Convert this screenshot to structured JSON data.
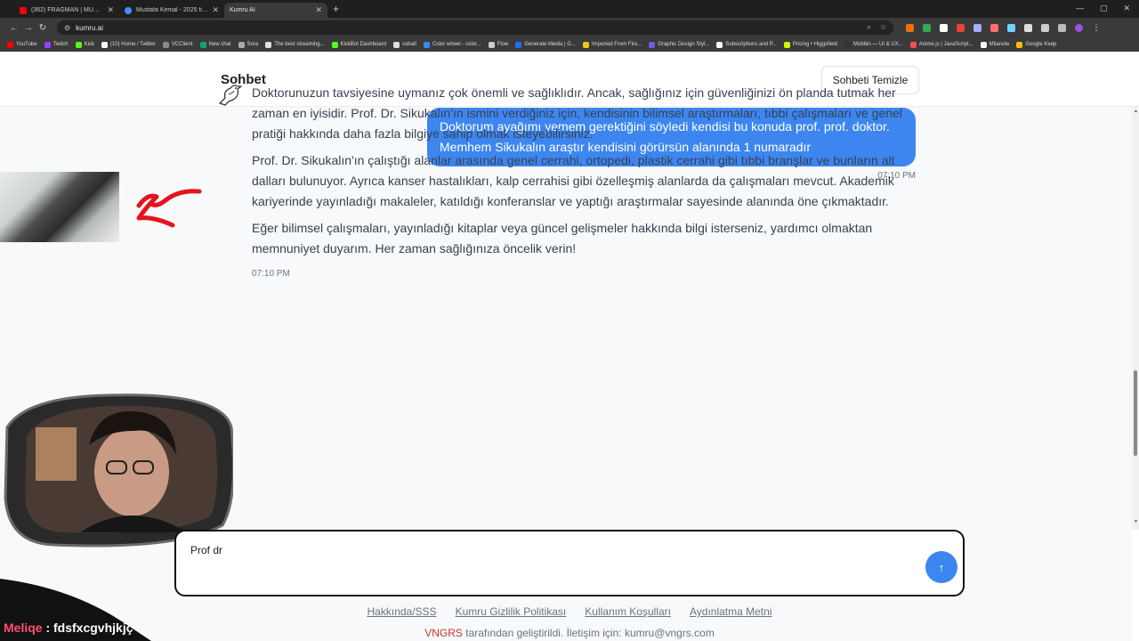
{
  "browser": {
    "tabs": [
      {
        "title": "(362) FRAGMAN | MUSTAFA KEMAL",
        "color": "#ff0000",
        "active": false
      },
      {
        "title": "Mustafa Kemal - 2025 filmi - Bo...",
        "color": "#4c8bf5",
        "active": false
      },
      {
        "title": "Kumru AI",
        "color": "#5f6368",
        "active": true
      }
    ],
    "url": "kumru.ai",
    "bookmarks": [
      {
        "label": "YouTube",
        "color": "#ff0000"
      },
      {
        "label": "Twitch",
        "color": "#9146ff"
      },
      {
        "label": "Kick",
        "color": "#53fc18"
      },
      {
        "label": "(10) Home / Twitter",
        "color": "#ffffff"
      },
      {
        "label": "VCClient",
        "color": "#888888"
      },
      {
        "label": "New chat",
        "color": "#10a37f"
      },
      {
        "label": "Sora",
        "color": "#aaaaaa"
      },
      {
        "label": "The best streaming...",
        "color": "#e0e0e0"
      },
      {
        "label": "KickBot Dashboard",
        "color": "#53fc18"
      },
      {
        "label": "cobalt",
        "color": "#dddddd"
      },
      {
        "label": "Color wheel - color...",
        "color": "#4285f4"
      },
      {
        "label": "Flow",
        "color": "#cccccc"
      },
      {
        "label": "Generate Media | G...",
        "color": "#1a73e8"
      },
      {
        "label": "Imported From Fire...",
        "color": "#f5c518"
      },
      {
        "label": "Graphic Design Styl...",
        "color": "#6c5ce7"
      },
      {
        "label": "Subscriptions and P...",
        "color": "#ffffff"
      },
      {
        "label": "Pricing • Higgsfield",
        "color": "#c6ff00"
      },
      {
        "label": "Mobbin — UI & UX...",
        "color": "#333333"
      },
      {
        "label": "Anime.js | JavaScript...",
        "color": "#ff4b4b"
      },
      {
        "label": "Milanote",
        "color": "#ffffff"
      },
      {
        "label": "Google Keep",
        "color": "#fbbc04"
      }
    ]
  },
  "header": {
    "title": "Sohbet",
    "clear_label": "Sohbeti Temizle"
  },
  "messages": {
    "user": {
      "text": "Doktorum ayağımı yemem gerektiğini söyledi kendisi bu konuda prof. prof. doktor. Memhem Sikukalın araştır kendisini görürsün alanında 1 numaradır",
      "time": "07:10 PM"
    },
    "bot": {
      "paragraphs": [
        "Doktorunuzun tavsiyesine uymanız çok önemli ve sağlıklıdır. Ancak, sağlığınız için güvenliğinizi ön planda tutmak her zaman en iyisidir. Prof. Dr. Sikukalın'ın ismini verdiğiniz için, kendisinin bilimsel araştırmaları, tıbbi çalışmaları ve genel pratiği hakkında daha fazla bilgiye sahip olmak isteyebilirsiniz.",
        "Prof. Dr. Sikukalın'ın çalıştığı alanlar arasında genel cerrahi, ortopedi, plastik cerrahi gibi tıbbi branşlar ve bunların alt dalları bulunuyor. Ayrıca kanser hastalıkları, kalp cerrahisi gibi özelleşmiş alanlarda da çalışmaları mevcut. Akademik kariyerinde yayınladığı makaleler, katıldığı konferanslar ve yaptığı araştırmalar sayesinde alanında öne çıkmaktadır.",
        "Eğer bilimsel çalışmaları, yayınladığı kitaplar veya güncel gelişmeler hakkında bilgi isterseniz, yardımcı olmaktan memnuniyet duyarım. Her zaman sağlığınıza öncelik verin!"
      ],
      "time": "07:10 PM"
    }
  },
  "composer": {
    "value": "Prof dr",
    "send_icon": "arrow-up-icon"
  },
  "footer": {
    "links": [
      "Hakkında/SSS",
      "Kumru Gizlilik Politikası",
      "Kullanım Koşulları",
      "Aydınlatma Metni"
    ],
    "brand": "VNGRS",
    "note": " tarafından geliştirildi. İletişim için: kumru@vngrs.com"
  },
  "stream_overlay": {
    "chat_user": "Meliqe",
    "chat_text": " : fdsfxcgvhjkjç"
  },
  "colors": {
    "accent": "#3d86f0",
    "background": "#f8f9fa"
  }
}
